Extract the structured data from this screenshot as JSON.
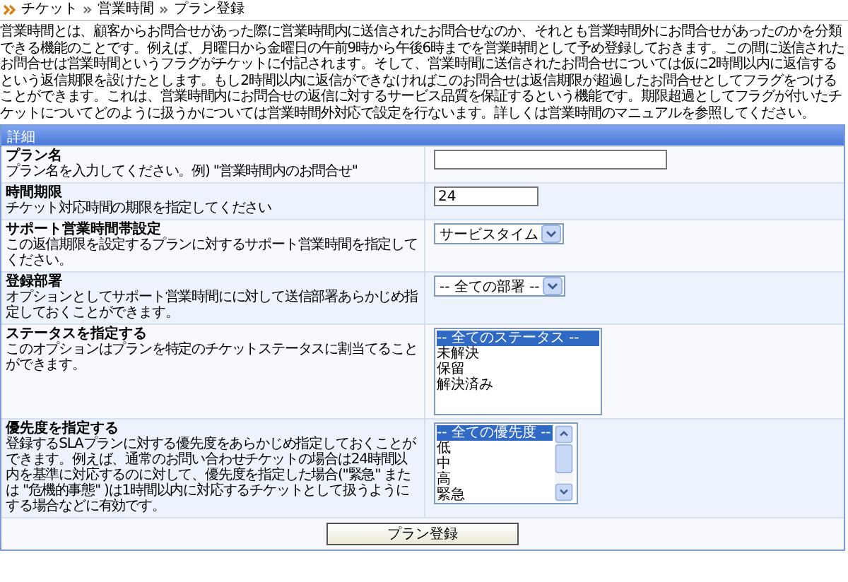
{
  "breadcrumb": [
    {
      "label": "チケット"
    },
    {
      "label": "営業時間"
    },
    {
      "label": "プラン登録"
    }
  ],
  "intro": "営業時間とは、顧客からお問合せがあった際に営業時間内に送信されたお問合せなのか、それとも営業時間外にお問合せがあったのかを分類できる機能のことです。例えば、月曜日から金曜日の午前9時から午後6時までを営業時間として予め登録しておきます。この間に送信されたお問合せは営業時間というフラグがチケットに付記されます。そして、営業時間に送信されたお問合せについては仮に2時間以内に返信するという返信期限を設けたとします。もし2時間以内に返信ができなければこのお問合せは返信期限が超過したお問合せとしてフラグをつけることができます。これは、営業時間内にお問合せの返信に対するサービス品質を保証するという機能です。期限超過としてフラグが付いたチケットについてどのように扱うかについては営業時間外対応で設定を行ないます。詳しくは営業時間のマニュアルを参照してください。",
  "section": {
    "title": "詳細"
  },
  "fields": [
    {
      "kind": "text",
      "label": "プラン名",
      "description": "プラン名を入力してください。例) \"営業時間内のお問合せ\""
    },
    {
      "kind": "text",
      "label": "時間期限",
      "description": "チケット対応時間の期限を指定してください",
      "value": "24"
    },
    {
      "kind": "select",
      "label": "サポート営業時間帯設定",
      "description": "この返信期限を設定するプランに対するサポート営業時間を指定してください。",
      "value": "サービスタイム"
    },
    {
      "kind": "select",
      "label": "登録部署",
      "description": "オプションとしてサポート営業時間にに対して送信部署あらかじめ指定しておくことができます。",
      "value": "-- 全ての部署 --"
    },
    {
      "kind": "list",
      "label": "ステータスを指定する",
      "description": "このオプションはプランを特定のチケットステータスに割当てることができます。",
      "scroll": false,
      "options": [
        {
          "label": "-- 全てのステータス --",
          "selected": true
        },
        {
          "label": "未解決",
          "selected": false
        },
        {
          "label": "保留",
          "selected": false
        },
        {
          "label": "解決済み",
          "selected": false
        }
      ]
    },
    {
      "kind": "list",
      "label": "優先度を指定する",
      "description": "登録するSLAプランに対する優先度をあらかじめ指定しておくことができます。例えば、通常のお問い合わせチケットの場合は24時間以内を基準に対応するのに対して、優先度を指定した場合(\"緊急\" または \"危機的事態\" )は1時間以内に対応するチケットとして扱うようにする場合などに有効です。",
      "scroll": true,
      "options": [
        {
          "label": "-- 全ての優先度 --",
          "selected": true
        },
        {
          "label": "低",
          "selected": false
        },
        {
          "label": "中",
          "selected": false
        },
        {
          "label": "高",
          "selected": false
        },
        {
          "label": "緊急",
          "selected": false
        }
      ]
    }
  ],
  "submit": "プラン登録"
}
